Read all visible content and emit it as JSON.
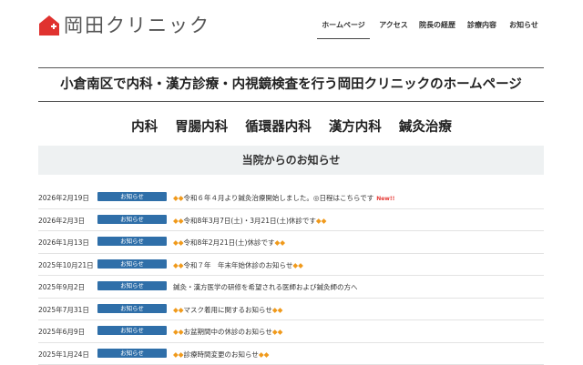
{
  "logo": {
    "text": "岡田クリニック"
  },
  "nav": [
    {
      "label": "ホームページ",
      "active": true
    },
    {
      "label": "アクセス",
      "active": false
    },
    {
      "label": "院長の経歴",
      "active": false
    },
    {
      "label": "診療内容",
      "active": false
    },
    {
      "label": "お知らせ",
      "active": false
    }
  ],
  "headline": "小倉南区で内科・漢方診療・内視鏡検査を行う岡田クリニックのホームページ",
  "departments": [
    "内科",
    "胃腸内科",
    "循環器内科",
    "漢方内科",
    "鍼灸治療"
  ],
  "news_heading": "当院からのお知らせ",
  "news": [
    {
      "date": "2026年2月19日",
      "badge": "お知らせ",
      "prefix": "◆◆",
      "title": "令和６年４月より鍼灸治療開始しました。◎日程はこちらです",
      "suffix": "",
      "new": "New!!"
    },
    {
      "date": "2026年2月3日",
      "badge": "お知らせ",
      "prefix": "◆◆",
      "title": "令和8年3月7日(土)・3月21日(土)休診です",
      "suffix": "◆◆",
      "new": ""
    },
    {
      "date": "2026年1月13日",
      "badge": "お知らせ",
      "prefix": "◆◆",
      "title": "令和8年2月21日(土)休診です",
      "suffix": "◆◆",
      "new": ""
    },
    {
      "date": "2025年10月21日",
      "badge": "お知らせ",
      "prefix": "◆◆",
      "title": "令和７年　年末年始休診のお知らせ",
      "suffix": "◆◆",
      "new": ""
    },
    {
      "date": "2025年9月2日",
      "badge": "お知らせ",
      "prefix": "",
      "title": "鍼灸・漢方医学の研修を希望される医師および鍼灸師の方へ",
      "suffix": "",
      "new": ""
    },
    {
      "date": "2025年7月31日",
      "badge": "お知らせ",
      "prefix": "◆◆",
      "title": "マスク着用に関するお知らせ",
      "suffix": "◆◆",
      "new": ""
    },
    {
      "date": "2025年6月9日",
      "badge": "お知らせ",
      "prefix": "◆◆",
      "title": "お盆期間中の休診のお知らせ",
      "suffix": "◆◆",
      "new": ""
    },
    {
      "date": "2025年1月24日",
      "badge": "お知らせ",
      "prefix": "◆◆",
      "title": "診療時間変更のお知らせ",
      "suffix": "◆◆",
      "new": ""
    }
  ],
  "colors": {
    "logo_red": "#e0322f",
    "badge_blue": "#2f6fa9",
    "diamond_orange": "#f09a1c",
    "news_bar_bg": "#eef1f2",
    "new_red": "#e53935"
  }
}
